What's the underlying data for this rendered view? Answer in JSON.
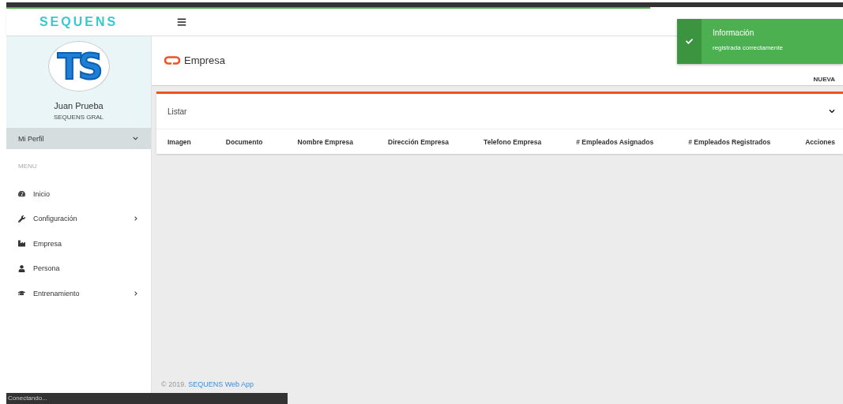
{
  "loading_bar": {
    "level": 0.77
  },
  "brand": {
    "logo": "SEQUENS"
  },
  "profile": {
    "avatar": "TS",
    "name": "Juan Prueba",
    "company": "SEQUENS GRAL",
    "menu_label": "Mi Perfil"
  },
  "sidebar": {
    "heading": "MENU",
    "items": [
      {
        "label": "Inicio",
        "kind": "dashboard",
        "has_submenu": false
      },
      {
        "label": "Configuración",
        "kind": "settings",
        "has_submenu": true
      },
      {
        "label": "Empresa",
        "kind": "company",
        "has_submenu": false
      },
      {
        "label": "Persona",
        "kind": "person",
        "has_submenu": false
      },
      {
        "label": "Entrenamiento",
        "kind": "training",
        "has_submenu": true
      }
    ]
  },
  "page": {
    "title": "Empresa",
    "action": "NUEVA"
  },
  "panel": {
    "title": "Listar",
    "expanded": true,
    "table": {
      "columns": [
        "Imagen",
        "Documento",
        "Nombre Empresa",
        "Dirección Empresa",
        "Telefono Empresa",
        "# Empleados Asignados",
        "# Empleados Registrados",
        "Acciones"
      ]
    }
  },
  "footer": {
    "copyright": "© 2019.",
    "link": "SEQUENS Web App"
  },
  "toast": {
    "title": "Información",
    "message": "registrada correctamente"
  },
  "status_bar": {
    "text": "Conectando..."
  }
}
